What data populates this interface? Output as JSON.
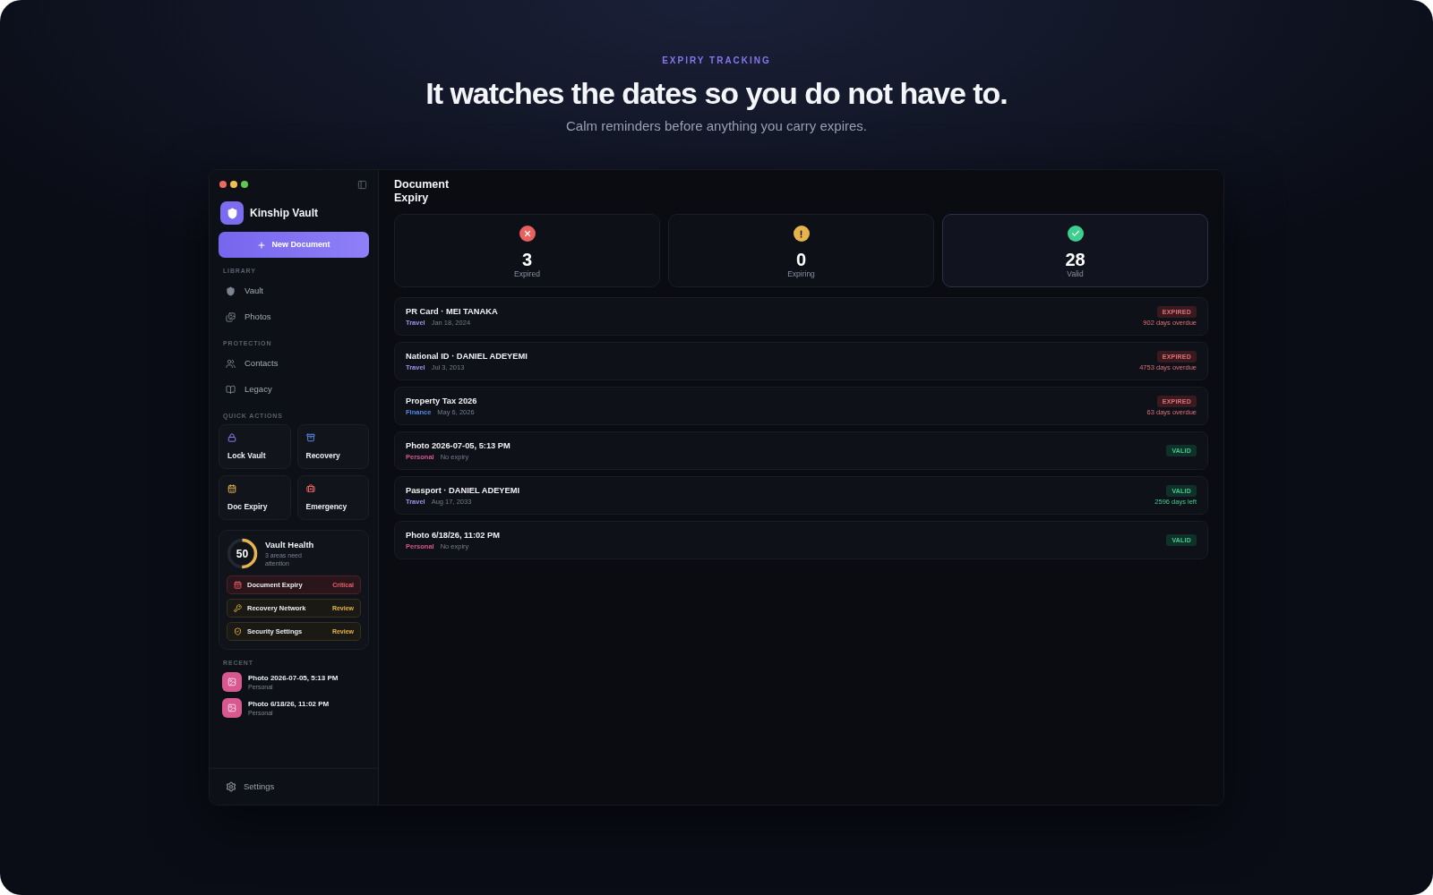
{
  "hero": {
    "eyebrow": "EXPIRY TRACKING",
    "title": "It watches the dates so you do not have to.",
    "subtitle": "Calm reminders before anything you carry expires."
  },
  "sidebar": {
    "app_name": "Kinship Vault",
    "new_document_button": "New Document",
    "sections": [
      {
        "title": "LIBRARY",
        "items": [
          {
            "label": "Vault",
            "selected": false
          },
          {
            "label": "Photos",
            "selected": false
          }
        ]
      },
      {
        "title": "PROTECTION",
        "items": [
          {
            "label": "Contacts",
            "selected": false
          },
          {
            "label": "Legacy",
            "selected": false
          }
        ]
      }
    ],
    "quick_actions": {
      "title": "QUICK ACTIONS",
      "items": [
        {
          "label": "Lock Vault"
        },
        {
          "label": "Recovery"
        },
        {
          "label": "Doc Expiry"
        },
        {
          "label": "Emergency"
        }
      ]
    },
    "vault_health": {
      "score": "50",
      "level": 0.5,
      "title": "Vault Health",
      "subtitle": "3 areas need attention",
      "items": [
        {
          "label": "Document Expiry",
          "status": "Critical",
          "kind": "critical"
        },
        {
          "label": "Recovery Network",
          "status": "Review",
          "kind": "review"
        },
        {
          "label": "Security Settings",
          "status": "Review",
          "kind": "review"
        }
      ]
    },
    "recent": {
      "title": "RECENT",
      "items": [
        {
          "title": "Photo 2026-07-05, 5:13 PM",
          "subtitle": "Personal"
        },
        {
          "title": "Photo 6/18/26, 11:02 PM",
          "subtitle": "Personal"
        }
      ]
    },
    "footer": {
      "settings": "Settings"
    }
  },
  "main": {
    "title": "Document Expiry",
    "stats": [
      {
        "value": "3",
        "label": "Expired",
        "kind": "expired",
        "selected": false
      },
      {
        "value": "0",
        "label": "Expiring",
        "kind": "expiring",
        "selected": false
      },
      {
        "value": "28",
        "label": "Valid",
        "kind": "valid",
        "selected": true
      }
    ],
    "documents": [
      {
        "title": "PR Card · MEI TANAKA",
        "category": {
          "label": "Travel",
          "color": "#9d95ea"
        },
        "date": "Jan 18, 2024",
        "kind": "expired",
        "badge": "EXPIRED",
        "note": "902 days overdue"
      },
      {
        "title": "National ID · DANIEL ADEYEMI",
        "category": {
          "label": "Travel",
          "color": "#9d95ea"
        },
        "date": "Jul 3, 2013",
        "kind": "expired",
        "badge": "EXPIRED",
        "note": "4753 days overdue"
      },
      {
        "title": "Property Tax 2026",
        "category": {
          "label": "Finance",
          "color": "#4f8be8"
        },
        "date": "May 6, 2026",
        "kind": "expired",
        "badge": "EXPIRED",
        "note": "63 days overdue"
      },
      {
        "title": "Photo 2026-07-05, 5:13 PM",
        "category": {
          "label": "Personal",
          "color": "#d8578f"
        },
        "date": "No expiry",
        "kind": "valid",
        "badge": "VALID"
      },
      {
        "title": "Passport · DANIEL ADEYEMI",
        "category": {
          "label": "Travel",
          "color": "#9d95ea"
        },
        "date": "Aug 17, 2033",
        "kind": "valid",
        "badge": "VALID",
        "note": "2596 days left"
      },
      {
        "title": "Photo 6/18/26, 11:02 PM",
        "category": {
          "label": "Personal",
          "color": "#d8578f"
        },
        "date": "No expiry",
        "kind": "valid",
        "badge": "VALID"
      }
    ]
  }
}
